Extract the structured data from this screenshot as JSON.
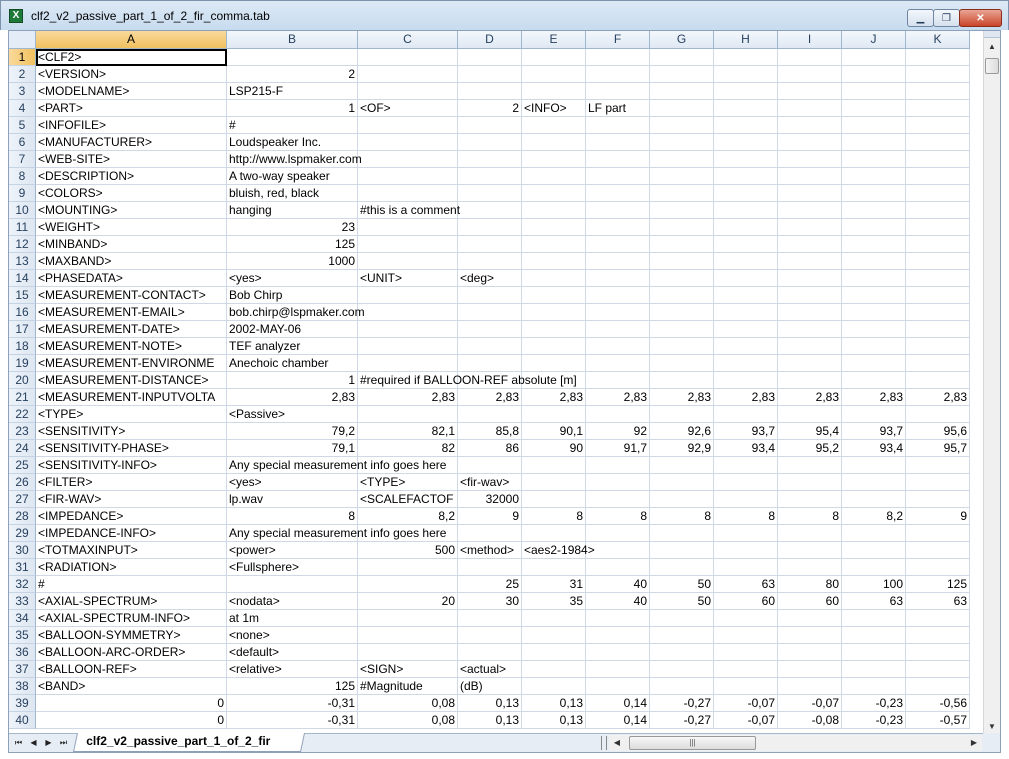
{
  "window": {
    "title": "clf2_v2_passive_part_1_of_2_fir_comma.tab",
    "icon": "excel-icon",
    "icon_glyph": "X",
    "minimize_glyph": "▁",
    "maximize_glyph": "❐",
    "close_glyph": "✕"
  },
  "columns": [
    "A",
    "B",
    "C",
    "D",
    "E",
    "F",
    "G",
    "H",
    "I",
    "J",
    "K"
  ],
  "active_column": "A",
  "active_row": 1,
  "rows": [
    {
      "n": "1",
      "cells": [
        "<CLF2>",
        "",
        "",
        "",
        "",
        "",
        "",
        "",
        "",
        "",
        ""
      ]
    },
    {
      "n": "2",
      "cells": [
        "<VERSION>",
        "2",
        "",
        "",
        "",
        "",
        "",
        "",
        "",
        "",
        ""
      ]
    },
    {
      "n": "3",
      "cells": [
        "<MODELNAME>",
        "LSP215-F",
        "",
        "",
        "",
        "",
        "",
        "",
        "",
        "",
        ""
      ]
    },
    {
      "n": "4",
      "cells": [
        "<PART>",
        "1",
        "<OF>",
        "2",
        "<INFO>",
        "LF part",
        "",
        "",
        "",
        "",
        ""
      ]
    },
    {
      "n": "5",
      "cells": [
        "<INFOFILE>",
        "#",
        "",
        "",
        "",
        "",
        "",
        "",
        "",
        "",
        ""
      ]
    },
    {
      "n": "6",
      "cells": [
        "<MANUFACTURER>",
        "Loudspeaker Inc.",
        "",
        "",
        "",
        "",
        "",
        "",
        "",
        "",
        ""
      ]
    },
    {
      "n": "7",
      "cells": [
        "<WEB-SITE>",
        "http://www.lspmaker.com",
        "",
        "",
        "",
        "",
        "",
        "",
        "",
        "",
        ""
      ]
    },
    {
      "n": "8",
      "cells": [
        "<DESCRIPTION>",
        "A two-way speaker",
        "",
        "",
        "",
        "",
        "",
        "",
        "",
        "",
        ""
      ]
    },
    {
      "n": "9",
      "cells": [
        "<COLORS>",
        "bluish, red, black",
        "",
        "",
        "",
        "",
        "",
        "",
        "",
        "",
        ""
      ]
    },
    {
      "n": "10",
      "cells": [
        "<MOUNTING>",
        "hanging",
        "#this is a comment",
        "",
        "",
        "",
        "",
        "",
        "",
        "",
        ""
      ]
    },
    {
      "n": "11",
      "cells": [
        "<WEIGHT>",
        "23",
        "",
        "",
        "",
        "",
        "",
        "",
        "",
        "",
        ""
      ]
    },
    {
      "n": "12",
      "cells": [
        "<MINBAND>",
        "125",
        "",
        "",
        "",
        "",
        "",
        "",
        "",
        "",
        ""
      ]
    },
    {
      "n": "13",
      "cells": [
        "<MAXBAND>",
        "1000",
        "",
        "",
        "",
        "",
        "",
        "",
        "",
        "",
        ""
      ]
    },
    {
      "n": "14",
      "cells": [
        "<PHASEDATA>",
        "<yes>",
        "<UNIT>",
        "<deg>",
        "",
        "",
        "",
        "",
        "",
        "",
        ""
      ]
    },
    {
      "n": "15",
      "cells": [
        "<MEASUREMENT-CONTACT>",
        "Bob Chirp",
        "",
        "",
        "",
        "",
        "",
        "",
        "",
        "",
        ""
      ]
    },
    {
      "n": "16",
      "cells": [
        "<MEASUREMENT-EMAIL>",
        "bob.chirp@lspmaker.com",
        "",
        "",
        "",
        "",
        "",
        "",
        "",
        "",
        ""
      ]
    },
    {
      "n": "17",
      "cells": [
        "<MEASUREMENT-DATE>",
        "2002-MAY-06",
        "",
        "",
        "",
        "",
        "",
        "",
        "",
        "",
        ""
      ]
    },
    {
      "n": "18",
      "cells": [
        "<MEASUREMENT-NOTE>",
        "TEF analyzer",
        "",
        "",
        "",
        "",
        "",
        "",
        "",
        "",
        ""
      ]
    },
    {
      "n": "19",
      "cells": [
        "<MEASUREMENT-ENVIRONME",
        "Anechoic chamber",
        "",
        "",
        "",
        "",
        "",
        "",
        "",
        "",
        ""
      ]
    },
    {
      "n": "20",
      "cells": [
        "<MEASUREMENT-DISTANCE>",
        "1",
        "#required if BALLOON-REF absolute [m]",
        "",
        "",
        "",
        "",
        "",
        "",
        "",
        ""
      ]
    },
    {
      "n": "21",
      "cells": [
        "<MEASUREMENT-INPUTVOLTA",
        "2,83",
        "2,83",
        "2,83",
        "2,83",
        "2,83",
        "2,83",
        "2,83",
        "2,83",
        "2,83",
        "2,83"
      ]
    },
    {
      "n": "22",
      "cells": [
        "<TYPE>",
        "<Passive>",
        "",
        "",
        "",
        "",
        "",
        "",
        "",
        "",
        ""
      ]
    },
    {
      "n": "23",
      "cells": [
        "<SENSITIVITY>",
        "79,2",
        "82,1",
        "85,8",
        "90,1",
        "92",
        "92,6",
        "93,7",
        "95,4",
        "93,7",
        "95,6"
      ]
    },
    {
      "n": "24",
      "cells": [
        "<SENSITIVITY-PHASE>",
        "79,1",
        "82",
        "86",
        "90",
        "91,7",
        "92,9",
        "93,4",
        "95,2",
        "93,4",
        "95,7"
      ]
    },
    {
      "n": "25",
      "cells": [
        "<SENSITIVITY-INFO>",
        "Any special measurement info goes here",
        "",
        "",
        "",
        "",
        "",
        "",
        "",
        "",
        ""
      ]
    },
    {
      "n": "26",
      "cells": [
        "<FILTER>",
        "<yes>",
        "<TYPE>",
        "<fir-wav>",
        "",
        "",
        "",
        "",
        "",
        "",
        ""
      ]
    },
    {
      "n": "27",
      "cells": [
        "<FIR-WAV>",
        "lp.wav",
        "<SCALEFACTOF",
        "32000",
        "",
        "",
        "",
        "",
        "",
        "",
        ""
      ]
    },
    {
      "n": "28",
      "cells": [
        "<IMPEDANCE>",
        "8",
        "8,2",
        "9",
        "8",
        "8",
        "8",
        "8",
        "8",
        "8,2",
        "9"
      ]
    },
    {
      "n": "29",
      "cells": [
        "<IMPEDANCE-INFO>",
        "Any special measurement info goes here",
        "",
        "",
        "",
        "",
        "",
        "",
        "",
        "",
        ""
      ]
    },
    {
      "n": "30",
      "cells": [
        "<TOTMAXINPUT>",
        "<power>",
        "500",
        "<method>",
        "<aes2-1984>",
        "",
        "",
        "",
        "",
        "",
        ""
      ]
    },
    {
      "n": "31",
      "cells": [
        "<RADIATION>",
        "<Fullsphere>",
        "",
        "",
        "",
        "",
        "",
        "",
        "",
        "",
        ""
      ]
    },
    {
      "n": "32",
      "cells": [
        "#",
        "",
        "",
        "25",
        "31",
        "40",
        "50",
        "63",
        "80",
        "100",
        "125"
      ]
    },
    {
      "n": "33",
      "cells": [
        "<AXIAL-SPECTRUM>",
        "<nodata>",
        "20",
        "30",
        "35",
        "40",
        "50",
        "60",
        "60",
        "63",
        "63"
      ]
    },
    {
      "n": "34",
      "cells": [
        "<AXIAL-SPECTRUM-INFO>",
        "at 1m",
        "",
        "",
        "",
        "",
        "",
        "",
        "",
        "",
        ""
      ]
    },
    {
      "n": "35",
      "cells": [
        "<BALLOON-SYMMETRY>",
        "<none>",
        "",
        "",
        "",
        "",
        "",
        "",
        "",
        "",
        ""
      ]
    },
    {
      "n": "36",
      "cells": [
        "<BALLOON-ARC-ORDER>",
        "<default>",
        "",
        "",
        "",
        "",
        "",
        "",
        "",
        "",
        ""
      ]
    },
    {
      "n": "37",
      "cells": [
        "<BALLOON-REF>",
        "<relative>",
        "<SIGN>",
        "<actual>",
        "",
        "",
        "",
        "",
        "",
        "",
        ""
      ]
    },
    {
      "n": "38",
      "cells": [
        "<BAND>",
        "125",
        "#Magnitude",
        "(dB)",
        "",
        "",
        "",
        "",
        "",
        "",
        ""
      ]
    },
    {
      "n": "39",
      "cells": [
        "0",
        "-0,31",
        "0,08",
        "0,13",
        "0,13",
        "0,14",
        "-0,27",
        "-0,07",
        "-0,07",
        "-0,23",
        "-0,56"
      ]
    },
    {
      "n": "40",
      "cells": [
        "0",
        "-0,31",
        "0,08",
        "0,13",
        "0,13",
        "0,14",
        "-0,27",
        "-0,07",
        "-0,08",
        "-0,23",
        "-0,57"
      ]
    }
  ],
  "sheet_tab": {
    "label": "clf2_v2_passive_part_1_of_2_fir"
  },
  "nav_buttons": [
    "⏮",
    "◀",
    "▶",
    "⏭"
  ],
  "scroll": {
    "up_glyph": "▲",
    "down_glyph": "▼",
    "left_glyph": "◀",
    "right_glyph": "▶",
    "thumb_grip": "|||"
  },
  "colors": {
    "active_header": "#f1c15f",
    "gridline": "#d0d7e5",
    "header_bg": "#dfe8f3"
  }
}
